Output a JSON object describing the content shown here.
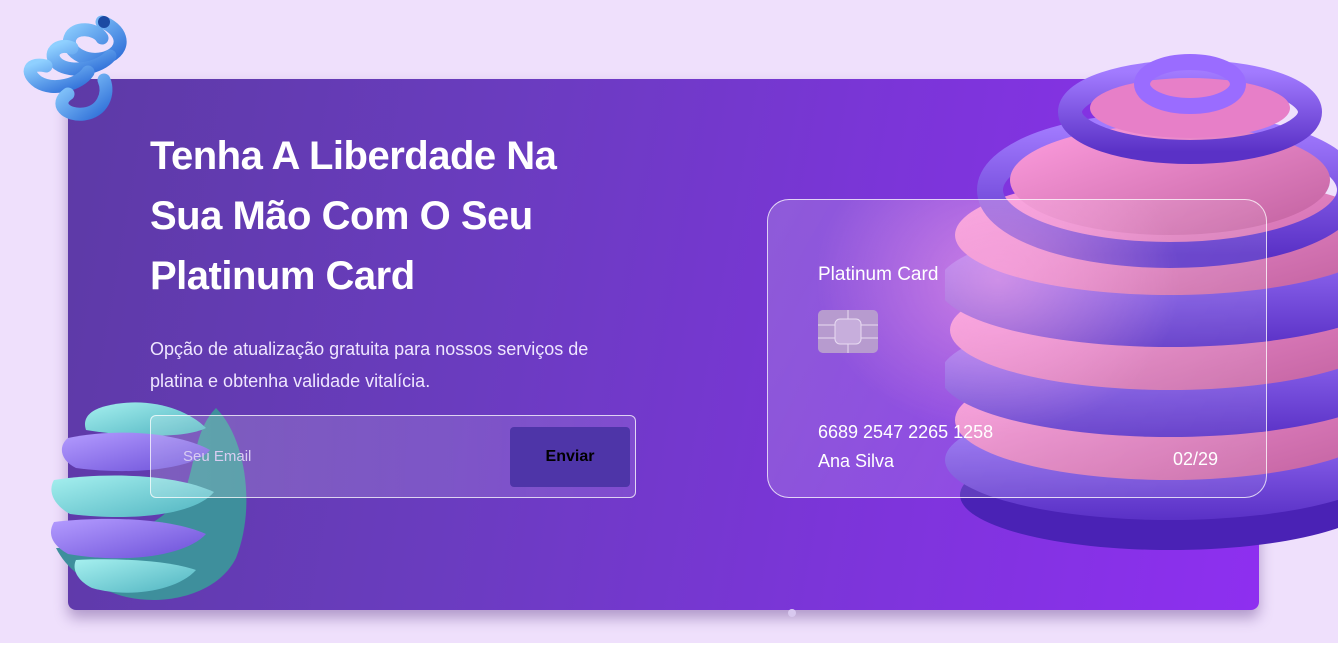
{
  "hero": {
    "headline": "Tenha A Liberdade Na Sua Mão Com O Seu Platinum Card",
    "subtitle": "Opção de atualização gratuita para nossos serviços de platina e obtenha validade vitalícia."
  },
  "form": {
    "email_placeholder": "Seu Email",
    "submit_label": "Enviar"
  },
  "card": {
    "title": "Platinum Card",
    "number": "6689 2547 2265 1258",
    "holder": "Ana Silva",
    "expiry": "02/29"
  },
  "colors": {
    "page_background": "#efe0fc",
    "banner_start": "#5d3aa6",
    "banner_end": "#8e2ff0",
    "button_background": "#4e35a8"
  },
  "icons": {
    "spring": "blue-spring-shape",
    "swirl": "teal-purple-swirl-shape",
    "stack": "purple-pink-ring-stack-shape",
    "chip": "card-chip-icon"
  }
}
